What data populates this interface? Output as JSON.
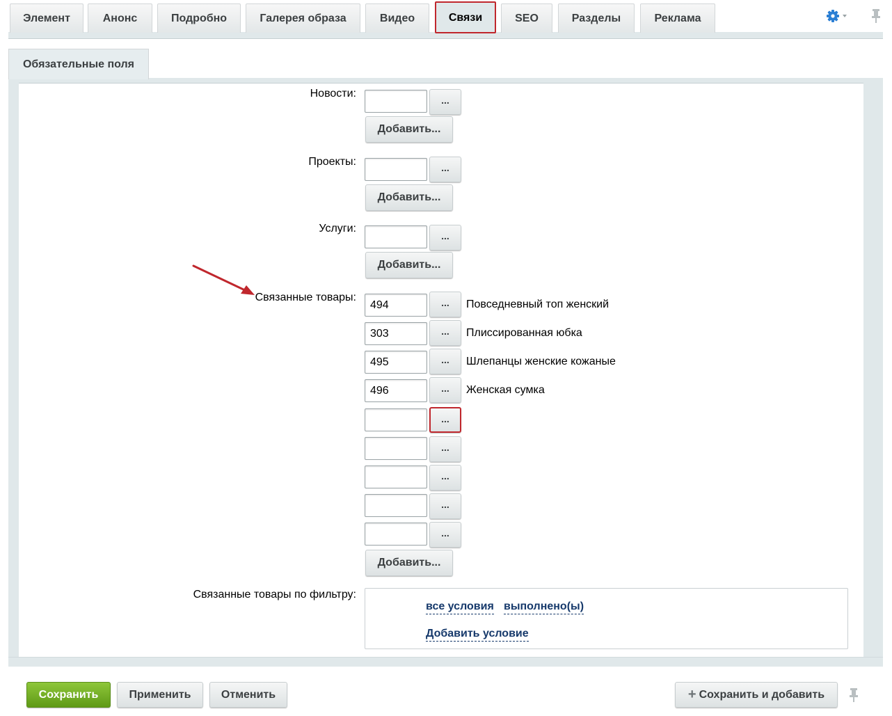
{
  "tabs": [
    {
      "label": "Элемент"
    },
    {
      "label": "Анонс"
    },
    {
      "label": "Подробно"
    },
    {
      "label": "Галерея образа"
    },
    {
      "label": "Видео"
    },
    {
      "label": "Связи",
      "active": true
    },
    {
      "label": "SEO"
    },
    {
      "label": "Разделы"
    },
    {
      "label": "Реклама"
    }
  ],
  "subtab": {
    "label": "Обязательные поля"
  },
  "fields": {
    "news": {
      "label": "Новости:",
      "value": "",
      "button": "...",
      "add": "Добавить..."
    },
    "projects": {
      "label": "Проекты:",
      "value": "",
      "button": "...",
      "add": "Добавить..."
    },
    "services": {
      "label": "Услуги:",
      "value": "",
      "button": "...",
      "add": "Добавить..."
    },
    "related": {
      "label": "Связанные товары:",
      "items": [
        {
          "value": "494",
          "name": "Повседневный топ женский"
        },
        {
          "value": "303",
          "name": "Плиссированная юбка"
        },
        {
          "value": "495",
          "name": "Шлепанцы женские кожаные"
        },
        {
          "value": "496",
          "name": "Женская сумка"
        },
        {
          "value": "",
          "name": ""
        },
        {
          "value": "",
          "name": ""
        },
        {
          "value": "",
          "name": ""
        },
        {
          "value": "",
          "name": ""
        },
        {
          "value": "",
          "name": ""
        }
      ],
      "button": "...",
      "add": "Добавить..."
    },
    "filter": {
      "label": "Связанные товары по фильтру:",
      "cond_all": "все условия",
      "cond_done": "выполнено(ы)",
      "add_condition": "Добавить условие"
    }
  },
  "footer": {
    "save": "Сохранить",
    "apply": "Применить",
    "cancel": "Отменить",
    "save_add": "Сохранить и добавить"
  },
  "icons": {
    "settings": "gear-icon",
    "pin": "pin-icon",
    "annotation": "red-arrow"
  },
  "colors": {
    "accent_green": "#6aa61f",
    "highlight_red": "#c0272d",
    "link_blue": "#16396b"
  }
}
